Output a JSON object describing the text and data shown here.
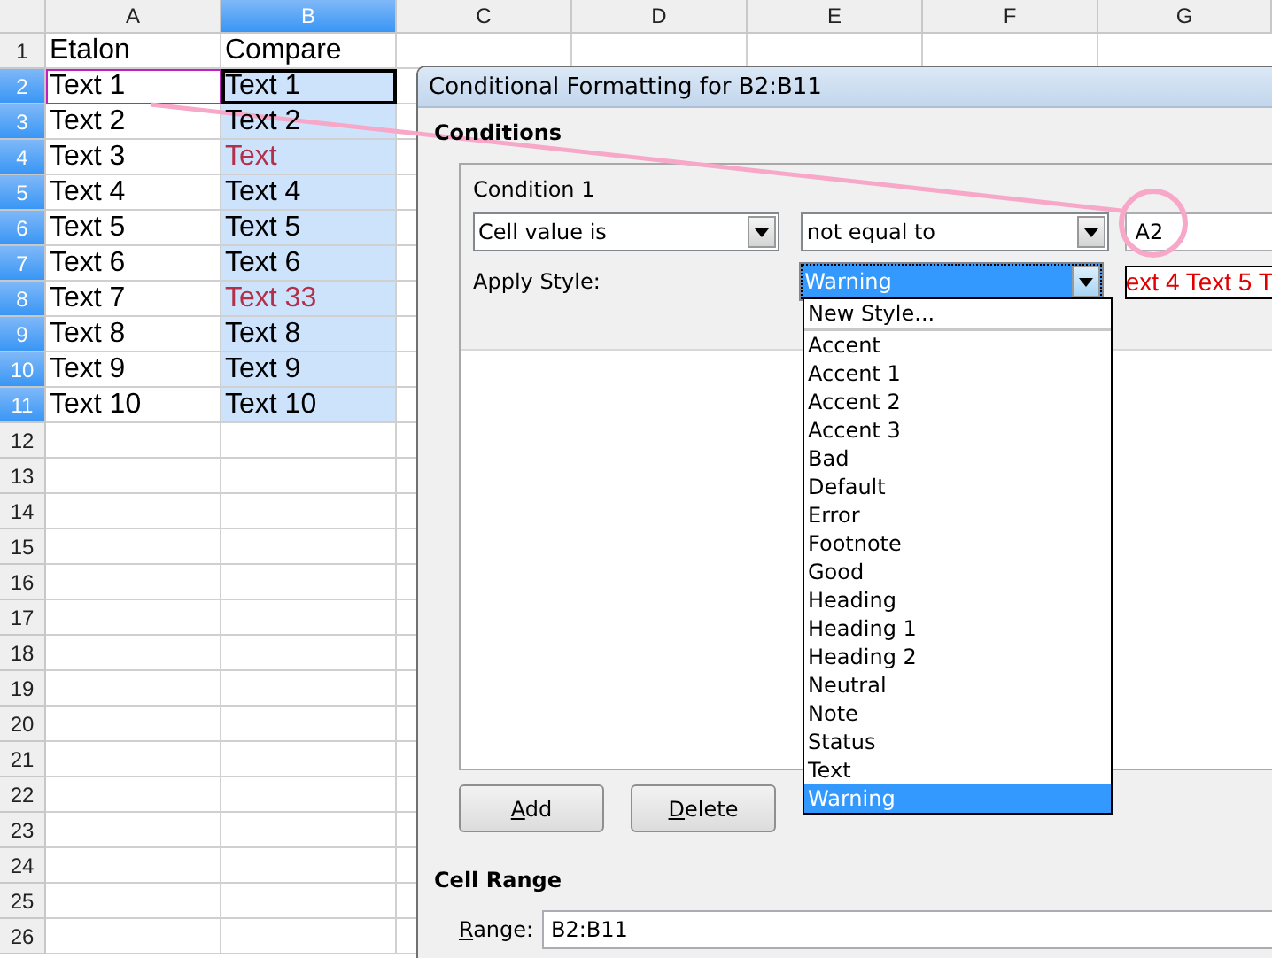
{
  "sheet": {
    "columns": [
      {
        "label": "A",
        "selected": false
      },
      {
        "label": "B",
        "selected": true
      },
      {
        "label": "C",
        "selected": false
      },
      {
        "label": "D",
        "selected": false
      },
      {
        "label": "E",
        "selected": false
      },
      {
        "label": "F",
        "selected": false
      },
      {
        "label": "G",
        "selected": false
      }
    ],
    "rows": [
      {
        "number": "1",
        "selected": false,
        "cells": [
          {
            "text": "Etalon",
            "selected": false,
            "active": false,
            "referenced": false,
            "warning": false
          },
          {
            "text": "Compare",
            "selected": false,
            "active": false,
            "referenced": false,
            "warning": false
          }
        ]
      },
      {
        "number": "2",
        "selected": true,
        "cells": [
          {
            "text": "Text 1",
            "selected": false,
            "active": false,
            "referenced": true,
            "warning": false
          },
          {
            "text": "Text 1",
            "selected": true,
            "active": true,
            "referenced": false,
            "warning": false
          }
        ]
      },
      {
        "number": "3",
        "selected": true,
        "cells": [
          {
            "text": "Text 2",
            "selected": false,
            "active": false,
            "referenced": false,
            "warning": false
          },
          {
            "text": "Text 2",
            "selected": true,
            "active": false,
            "referenced": false,
            "warning": false
          }
        ]
      },
      {
        "number": "4",
        "selected": true,
        "cells": [
          {
            "text": "Text 3",
            "selected": false,
            "active": false,
            "referenced": false,
            "warning": false
          },
          {
            "text": "Text",
            "selected": true,
            "active": false,
            "referenced": false,
            "warning": true
          }
        ]
      },
      {
        "number": "5",
        "selected": true,
        "cells": [
          {
            "text": "Text 4",
            "selected": false,
            "active": false,
            "referenced": false,
            "warning": false
          },
          {
            "text": "Text 4",
            "selected": true,
            "active": false,
            "referenced": false,
            "warning": false
          }
        ]
      },
      {
        "number": "6",
        "selected": true,
        "cells": [
          {
            "text": "Text 5",
            "selected": false,
            "active": false,
            "referenced": false,
            "warning": false
          },
          {
            "text": "Text 5",
            "selected": true,
            "active": false,
            "referenced": false,
            "warning": false
          }
        ]
      },
      {
        "number": "7",
        "selected": true,
        "cells": [
          {
            "text": "Text 6",
            "selected": false,
            "active": false,
            "referenced": false,
            "warning": false
          },
          {
            "text": "Text 6",
            "selected": true,
            "active": false,
            "referenced": false,
            "warning": false
          }
        ]
      },
      {
        "number": "8",
        "selected": true,
        "cells": [
          {
            "text": "Text 7",
            "selected": false,
            "active": false,
            "referenced": false,
            "warning": false
          },
          {
            "text": "Text 33",
            "selected": true,
            "active": false,
            "referenced": false,
            "warning": true
          }
        ]
      },
      {
        "number": "9",
        "selected": true,
        "cells": [
          {
            "text": "Text 8",
            "selected": false,
            "active": false,
            "referenced": false,
            "warning": false
          },
          {
            "text": "Text 8",
            "selected": true,
            "active": false,
            "referenced": false,
            "warning": false
          }
        ]
      },
      {
        "number": "10",
        "selected": true,
        "cells": [
          {
            "text": "Text 9",
            "selected": false,
            "active": false,
            "referenced": false,
            "warning": false
          },
          {
            "text": "Text 9",
            "selected": true,
            "active": false,
            "referenced": false,
            "warning": false
          }
        ]
      },
      {
        "number": "11",
        "selected": true,
        "cells": [
          {
            "text": "Text 10",
            "selected": false,
            "active": false,
            "referenced": false,
            "warning": false
          },
          {
            "text": "Text 10",
            "selected": true,
            "active": false,
            "referenced": false,
            "warning": false
          }
        ]
      },
      {
        "number": "12",
        "selected": false
      },
      {
        "number": "13",
        "selected": false
      },
      {
        "number": "14",
        "selected": false
      },
      {
        "number": "15",
        "selected": false
      },
      {
        "number": "16",
        "selected": false
      },
      {
        "number": "17",
        "selected": false
      },
      {
        "number": "18",
        "selected": false
      },
      {
        "number": "19",
        "selected": false
      },
      {
        "number": "20",
        "selected": false
      },
      {
        "number": "21",
        "selected": false
      },
      {
        "number": "22",
        "selected": false
      },
      {
        "number": "23",
        "selected": false
      },
      {
        "number": "24",
        "selected": false
      },
      {
        "number": "25",
        "selected": false
      },
      {
        "number": "26",
        "selected": false
      }
    ]
  },
  "dialog": {
    "title": "Conditional Formatting for B2:B11",
    "conditions_label": "Conditions",
    "condition": {
      "title": "Condition 1",
      "type": "Cell value is",
      "operator": "not equal to",
      "value": "A2",
      "apply_style_label": "Apply Style:",
      "style": "Warning",
      "style_expanded": true,
      "preview": "ext 4 Text 5 T",
      "style_options": [
        {
          "label": "New Style...",
          "selected": false
        },
        {
          "label": "Accent",
          "selected": false
        },
        {
          "label": "Accent 1",
          "selected": false
        },
        {
          "label": "Accent 2",
          "selected": false
        },
        {
          "label": "Accent 3",
          "selected": false
        },
        {
          "label": "Bad",
          "selected": false
        },
        {
          "label": "Default",
          "selected": false
        },
        {
          "label": "Error",
          "selected": false
        },
        {
          "label": "Footnote",
          "selected": false
        },
        {
          "label": "Good",
          "selected": false
        },
        {
          "label": "Heading",
          "selected": false
        },
        {
          "label": "Heading 1",
          "selected": false
        },
        {
          "label": "Heading 2",
          "selected": false
        },
        {
          "label": "Neutral",
          "selected": false
        },
        {
          "label": "Note",
          "selected": false
        },
        {
          "label": "Status",
          "selected": false
        },
        {
          "label": "Text",
          "selected": false
        },
        {
          "label": "Warning",
          "selected": true
        }
      ]
    },
    "buttons": [
      "Add",
      "Delete"
    ],
    "cell_range_label": "Cell Range",
    "range_label": "Range:",
    "range": "B2:B11"
  }
}
